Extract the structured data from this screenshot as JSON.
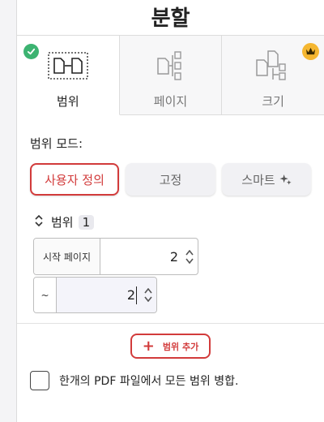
{
  "title": "분할",
  "tabs": [
    {
      "label": "범위",
      "active": true,
      "badge": "check-icon"
    },
    {
      "label": "페이지",
      "active": false,
      "badge": ""
    },
    {
      "label": "크기",
      "active": false,
      "badge": "crown-icon"
    }
  ],
  "mode": {
    "label": "범위 모드:",
    "options": [
      "사용자 정의",
      "고정",
      "스마트"
    ],
    "selected": "사용자 정의"
  },
  "range": {
    "heading": "범위",
    "index": "1",
    "start_prefix": "시작 페이지",
    "start_value": "2",
    "end_prefix": "~",
    "end_value": "2"
  },
  "add_range_label": "범위 추가",
  "merge_label": "한개의 PDF 파일에서 모든 범위 병합.",
  "colors": {
    "accent": "#d23b3b",
    "check": "#3cb371",
    "crown": "#f5b731"
  }
}
